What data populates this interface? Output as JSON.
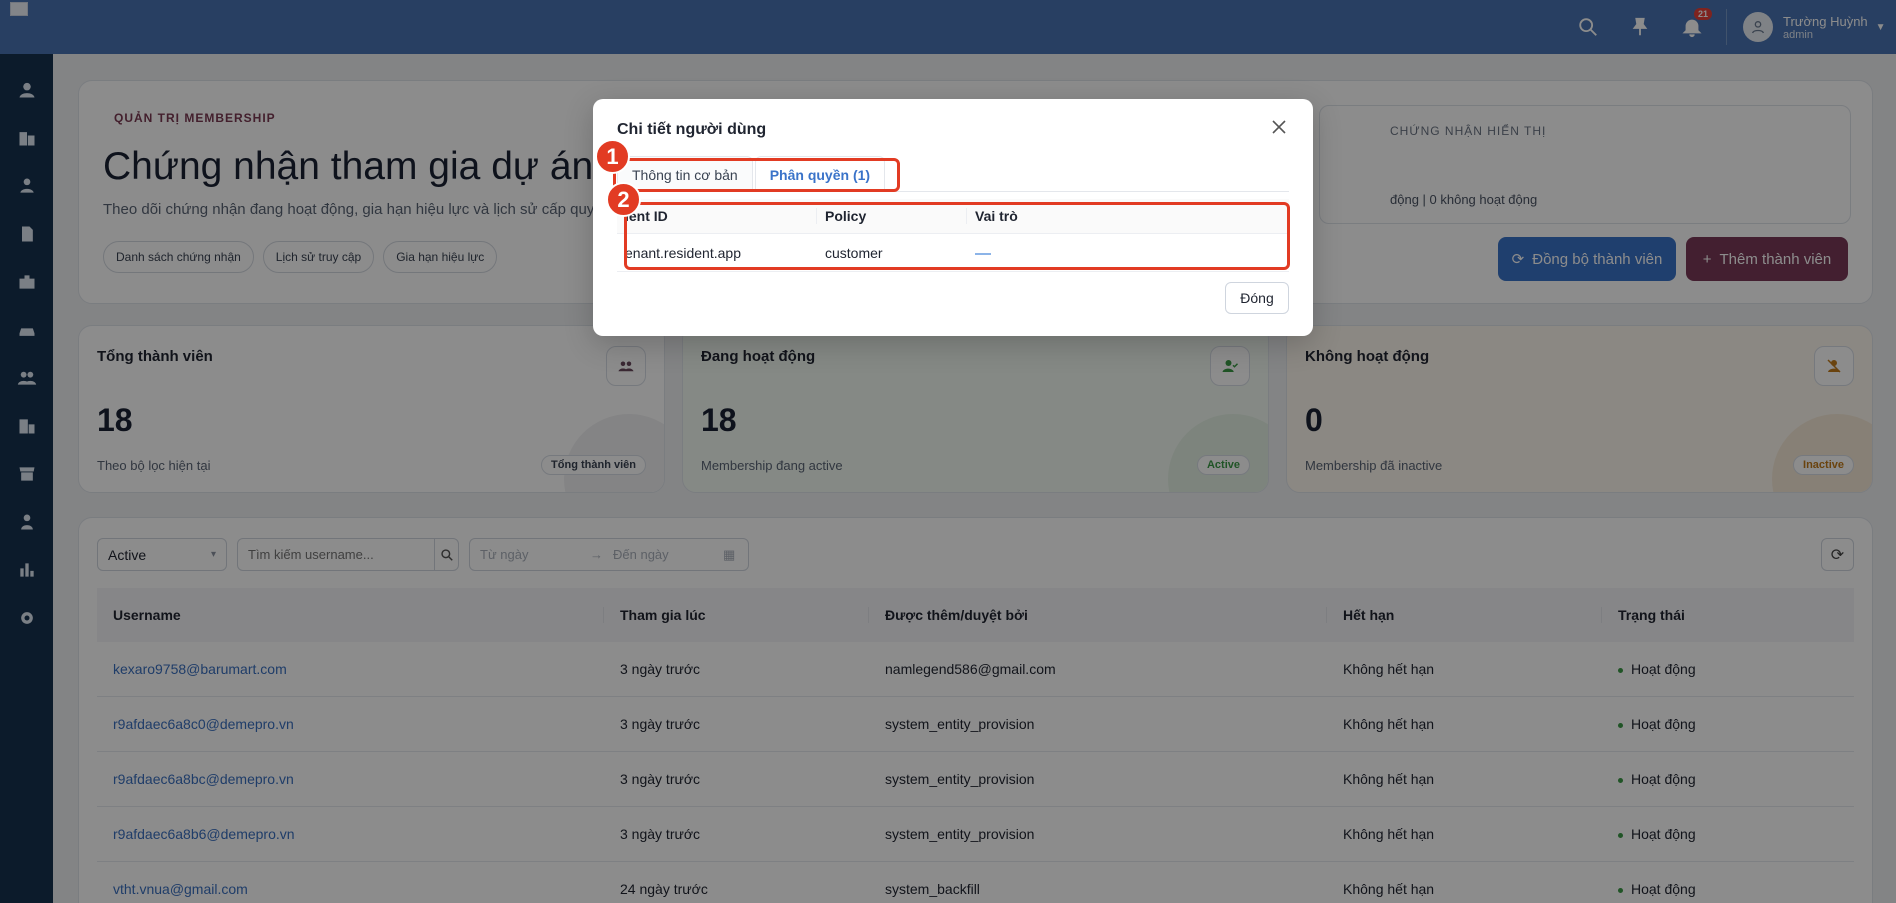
{
  "topbar": {
    "notification_count": "21",
    "user_name": "Trường Huỳnh",
    "user_role": "admin"
  },
  "sidebar": {
    "items": [
      "user-icon",
      "building-icon",
      "users-gear-icon",
      "document-icon",
      "briefcase-icon",
      "car-icon",
      "group-icon",
      "building-grid-icon",
      "store-icon",
      "person-icon",
      "chart-icon",
      "settings-icon"
    ]
  },
  "hero": {
    "eyebrow": "QUẢN TRỊ MEMBERSHIP",
    "title": "Chứng nhận tham gia dự án",
    "subtitle": "Theo dõi chứng nhận đang hoạt động, gia hạn hiệu lực và lịch sử cấp quyề",
    "chips": [
      "Danh sách chứng nhận",
      "Lịch sử truy cập",
      "Gia hạn hiệu lực"
    ],
    "cert_label": "CHỨNG NHẬN HIỂN THỊ",
    "cert_text": "động | 0 không hoạt động",
    "sync_button": "Đồng bộ thành viên",
    "add_button": "Thêm thành viên"
  },
  "stats": [
    {
      "title": "Tổng thành viên",
      "value": "18",
      "foot": "Theo bộ lọc hiện tại",
      "tag": "Tổng thành viên",
      "color": "#3a4352"
    },
    {
      "title": "Đang hoạt động",
      "value": "18",
      "foot": "Membership đang active",
      "tag": "Active",
      "color": "#3b9a45"
    },
    {
      "title": "Không hoạt động",
      "value": "0",
      "foot": "Membership đã inactive",
      "tag": "Inactive",
      "color": "#c27a1a"
    }
  ],
  "filters": {
    "status": "Active",
    "search_placeholder": "Tìm kiếm username...",
    "from_placeholder": "Từ ngày",
    "to_placeholder": "Đến ngày"
  },
  "table": {
    "headers": [
      "Username",
      "Tham gia lúc",
      "Được thêm/duyệt bởi",
      "Hết hạn",
      "Trạng thái"
    ],
    "rows": [
      [
        "kexaro9758@barumart.com",
        "3 ngày trước",
        "namlegend586@gmail.com",
        "Không hết hạn",
        "Hoạt động"
      ],
      [
        "r9afdaec6a8c0@demepro.vn",
        "3 ngày trước",
        "system_entity_provision",
        "Không hết hạn",
        "Hoạt động"
      ],
      [
        "r9afdaec6a8bc@demepro.vn",
        "3 ngày trước",
        "system_entity_provision",
        "Không hết hạn",
        "Hoạt động"
      ],
      [
        "r9afdaec6a8b6@demepro.vn",
        "3 ngày trước",
        "system_entity_provision",
        "Không hết hạn",
        "Hoạt động"
      ],
      [
        "vtht.vnua@gmail.com",
        "24 ngày trước",
        "system_backfill",
        "Không hết hạn",
        "Hoạt động"
      ]
    ]
  },
  "modal": {
    "title": "Chi tiết người dùng",
    "tabs": [
      "Thông tin cơ bản",
      "Phân quyền (1)"
    ],
    "headers": [
      "ient ID",
      "Policy",
      "Vai trò"
    ],
    "row": [
      "enant.resident.app",
      "customer"
    ],
    "close_button": "Đóng"
  },
  "annotations": {
    "marker1": "1",
    "marker2": "2",
    "color": "#e23b23"
  }
}
